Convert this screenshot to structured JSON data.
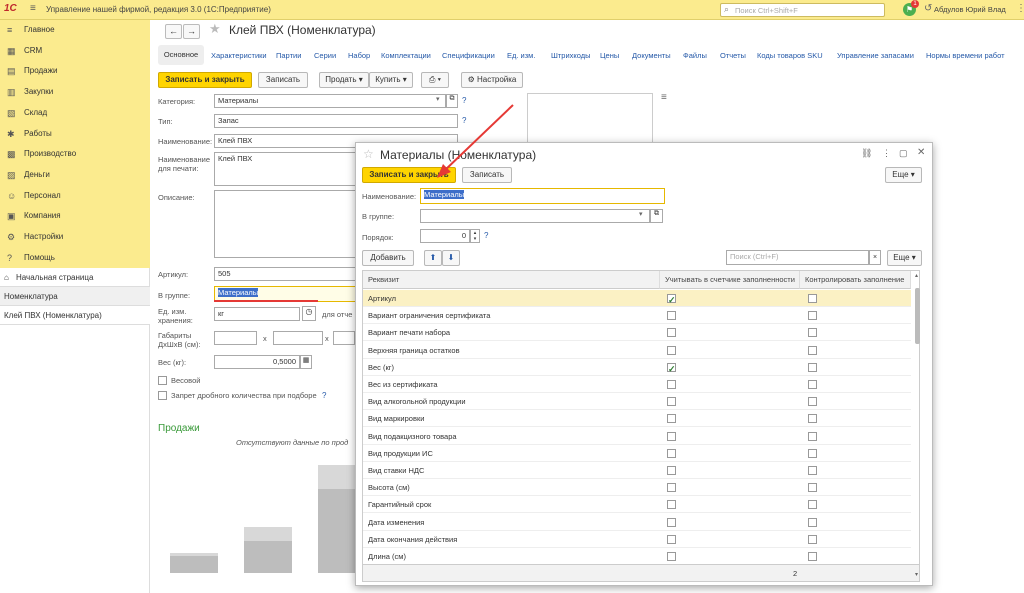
{
  "topbar": {
    "logo": "1С",
    "menu_icon": "≡",
    "title": "Управление нашей фирмой, редакция 3.0  (1С:Предприятие)",
    "search_placeholder": "Поиск Ctrl+Shift+F",
    "notif_count": "1",
    "user": "Абдулов Юрий Влад"
  },
  "sidebar": {
    "items": [
      {
        "icon": "≡",
        "label": "Главное"
      },
      {
        "icon": "▦",
        "label": "CRM"
      },
      {
        "icon": "▤",
        "label": "Продажи"
      },
      {
        "icon": "▥",
        "label": "Закупки"
      },
      {
        "icon": "▧",
        "label": "Склад"
      },
      {
        "icon": "✱",
        "label": "Работы"
      },
      {
        "icon": "▩",
        "label": "Производство"
      },
      {
        "icon": "▨",
        "label": "Деньги"
      },
      {
        "icon": "☺",
        "label": "Персонал"
      },
      {
        "icon": "▣",
        "label": "Компания"
      },
      {
        "icon": "⚙",
        "label": "Настройки"
      },
      {
        "icon": "?",
        "label": "Помощь"
      }
    ],
    "lower": [
      {
        "label": "Начальная страница",
        "icon": "⌂"
      },
      {
        "label": "Номенклатура"
      },
      {
        "label": "Клей ПВХ (Номенклатура)"
      }
    ]
  },
  "form": {
    "title": "Клей ПВХ (Номенклатура)",
    "tabs": [
      "Основное",
      "Характеристики",
      "Партии",
      "Серии",
      "Набор",
      "Комплектации",
      "Спецификации",
      "Ед. изм.",
      "Штрихкоды",
      "Цены",
      "Документы",
      "Файлы",
      "Отчеты",
      "Коды товаров SKU",
      "Управление запасами",
      "Нормы времени работ"
    ],
    "buttons": {
      "save_close": "Записать и закрыть",
      "save": "Записать",
      "sell": "Продать",
      "buy": "Купить",
      "settings": "Настройка"
    },
    "fields": {
      "category_label": "Категория:",
      "category": "Материалы",
      "type_label": "Тип:",
      "type": "Запас",
      "name_label": "Наименование:",
      "name": "Клей ПВХ",
      "print_name_label": "Наименование для печати:",
      "print_name": "Клей ПВХ",
      "desc_label": "Описание:",
      "article_label": "Артикул:",
      "article": "505",
      "group_label": "В группе:",
      "group": "Материалы",
      "unit_label": "Ед. изм. хранения:",
      "unit": "кг",
      "unit_extra": "для отче",
      "dims_label": "Габариты ДхШхВ (см):",
      "dims_x": "x",
      "weight_label": "Вес (кг):",
      "weight": "0,5000",
      "weighted": "Весовой",
      "fraction": "Запрет дробного количества при подборе",
      "q": "?"
    },
    "sales": {
      "title": "Продажи",
      "empty": "Отсутствуют данные по прод"
    }
  },
  "dialog": {
    "title": "Материалы (Номенклатура)",
    "save_close": "Записать и закрыть",
    "save": "Записать",
    "more": "Еще",
    "name_label": "Наименование:",
    "name": "Материалы",
    "group_label": "В группе:",
    "order_label": "Порядок:",
    "order": "0",
    "add": "Добавить",
    "search_placeholder": "Поиск (Ctrl+F)",
    "more2": "Еще",
    "columns": [
      "Реквизит",
      "Учитывать в счетчике заполненности",
      "Контролировать заполнение"
    ],
    "rows": [
      {
        "name": "Артикул",
        "c1": true,
        "c2": false
      },
      {
        "name": "Вариант ограничения сертификата",
        "c1": false,
        "c2": false
      },
      {
        "name": "Вариант печати набора",
        "c1": false,
        "c2": false
      },
      {
        "name": "Верхняя граница остатков",
        "c1": false,
        "c2": false
      },
      {
        "name": "Вес (кг)",
        "c1": true,
        "c2": false
      },
      {
        "name": "Вес из сертификата",
        "c1": false,
        "c2": false
      },
      {
        "name": "Вид алкогольной продукции",
        "c1": false,
        "c2": false
      },
      {
        "name": "Вид маркировки",
        "c1": false,
        "c2": false
      },
      {
        "name": "Вид подакцизного товара",
        "c1": false,
        "c2": false
      },
      {
        "name": "Вид продукции ИС",
        "c1": false,
        "c2": false
      },
      {
        "name": "Вид ставки НДС",
        "c1": false,
        "c2": false
      },
      {
        "name": "Высота (см)",
        "c1": false,
        "c2": false
      },
      {
        "name": "Гарантийный срок",
        "c1": false,
        "c2": false
      },
      {
        "name": "Дата изменения",
        "c1": false,
        "c2": false
      },
      {
        "name": "Дата окончания действия",
        "c1": false,
        "c2": false
      },
      {
        "name": "Длина (см)",
        "c1": false,
        "c2": false
      }
    ],
    "footer_count": "2"
  },
  "colors": {
    "accent": "#fbeb8e",
    "button": "#ffd400",
    "link": "#2559a8",
    "arrow": "#e53935"
  }
}
